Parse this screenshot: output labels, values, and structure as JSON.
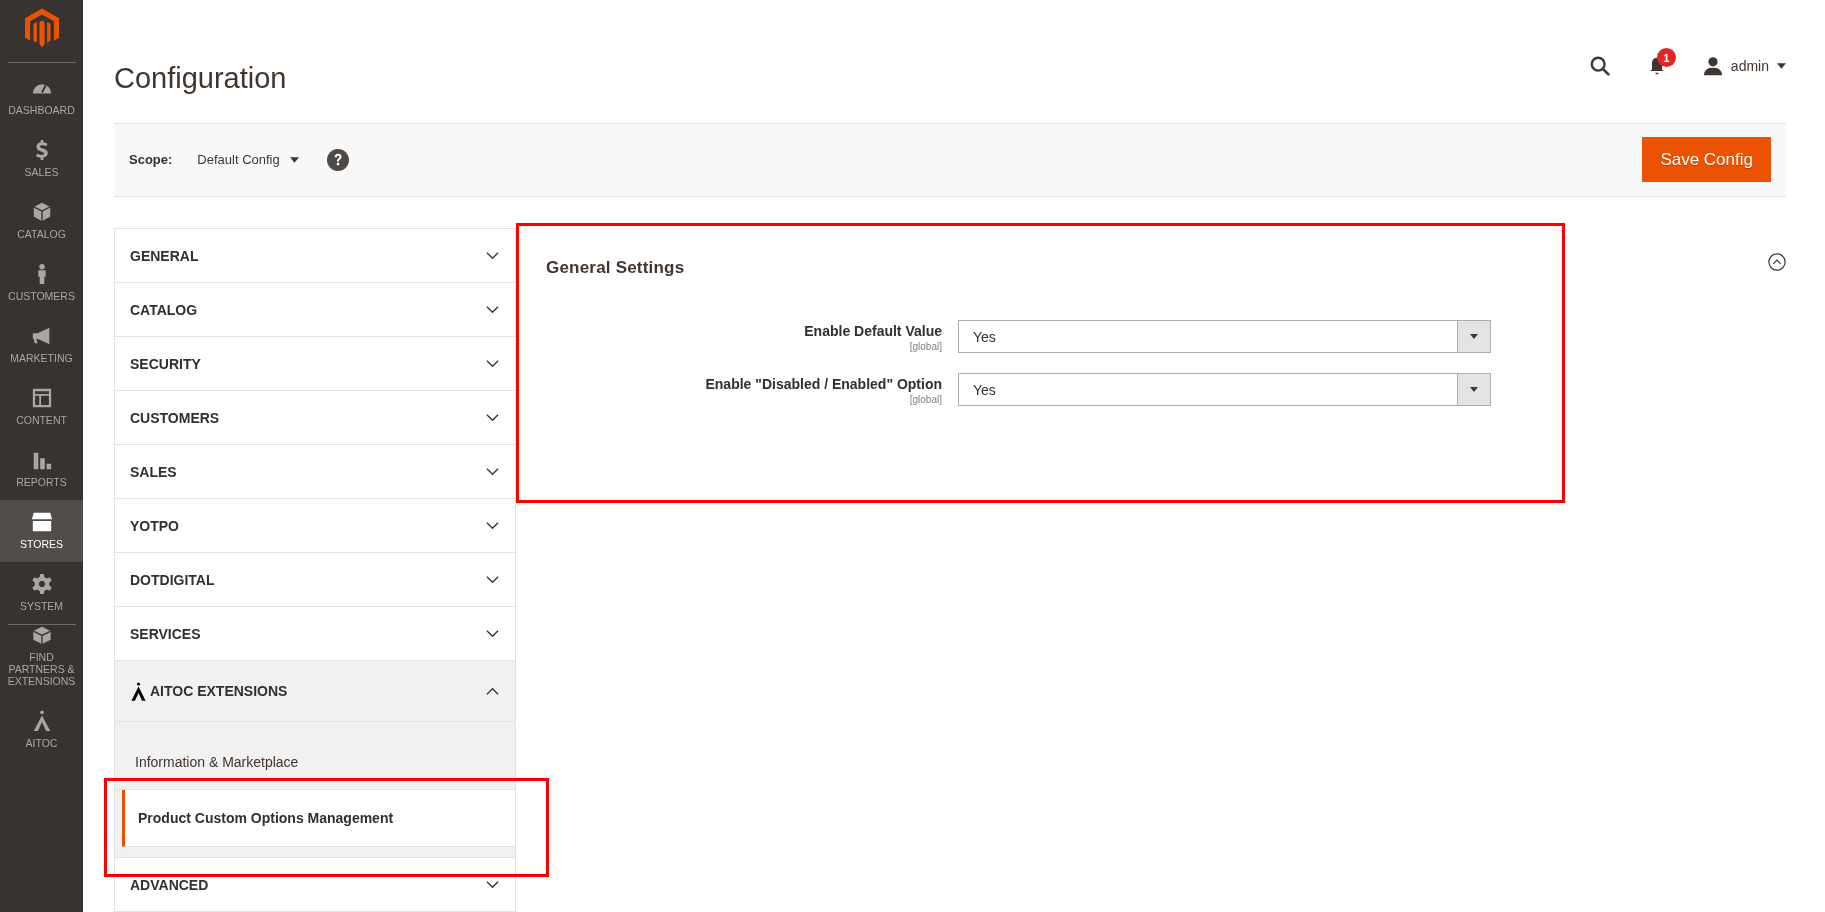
{
  "nav": [
    {
      "label": "DASHBOARD",
      "selected": false
    },
    {
      "label": "SALES",
      "selected": false
    },
    {
      "label": "CATALOG",
      "selected": false
    },
    {
      "label": "CUSTOMERS",
      "selected": false
    },
    {
      "label": "MARKETING",
      "selected": false
    },
    {
      "label": "CONTENT",
      "selected": false
    },
    {
      "label": "REPORTS",
      "selected": false
    },
    {
      "label": "STORES",
      "selected": true
    },
    {
      "label": "SYSTEM",
      "selected": false
    },
    {
      "label": "FIND PARTNERS & EXTENSIONS",
      "selected": false
    },
    {
      "label": "AITOC",
      "selected": false
    }
  ],
  "header": {
    "title": "Configuration",
    "notifications": "1",
    "user": "admin"
  },
  "scope": {
    "label": "Scope:",
    "value": "Default Config"
  },
  "save_button": "Save Config",
  "tabs": [
    {
      "label": "GENERAL",
      "kind": "plain",
      "expanded": false
    },
    {
      "label": "CATALOG",
      "kind": "plain",
      "expanded": false
    },
    {
      "label": "SECURITY",
      "kind": "plain",
      "expanded": false
    },
    {
      "label": "CUSTOMERS",
      "kind": "plain",
      "expanded": false
    },
    {
      "label": "SALES",
      "kind": "plain",
      "expanded": false
    },
    {
      "label": "YOTPO",
      "kind": "plain",
      "expanded": false
    },
    {
      "label": "DOTDIGITAL",
      "kind": "plain",
      "expanded": false
    },
    {
      "label": "SERVICES",
      "kind": "plain",
      "expanded": false
    },
    {
      "label": "AITOC EXTENSIONS",
      "kind": "logo",
      "expanded": true,
      "children": [
        {
          "label": "Information & Marketplace",
          "selected": false
        },
        {
          "label": "Product Custom Options Management",
          "selected": true
        }
      ]
    },
    {
      "label": "ADVANCED",
      "kind": "plain",
      "expanded": false
    }
  ],
  "section": {
    "title": "General Settings",
    "expanded": true,
    "fields": [
      {
        "label": "Enable Default Value",
        "scope": "[global]",
        "value": "Yes"
      },
      {
        "label": "Enable \"Disabled / Enabled\" Option",
        "scope": "[global]",
        "value": "Yes"
      }
    ]
  }
}
